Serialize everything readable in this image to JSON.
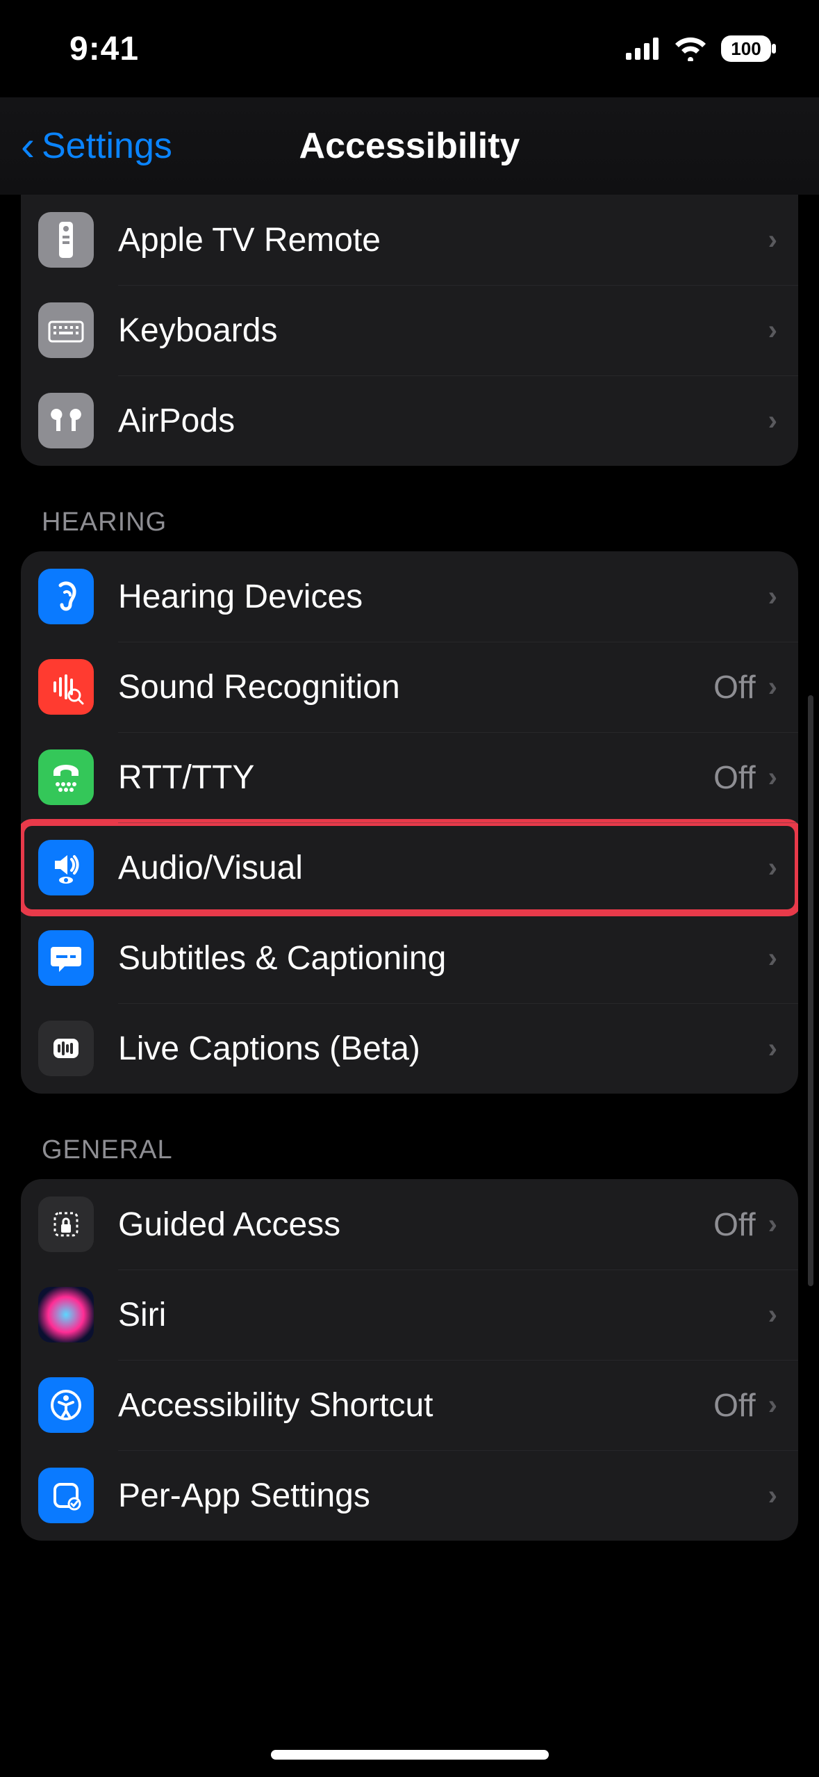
{
  "status": {
    "time": "9:41",
    "battery": "100"
  },
  "nav": {
    "back": "Settings",
    "title": "Accessibility"
  },
  "sections": {
    "physical": {
      "items": [
        {
          "label": "Apple TV Remote"
        },
        {
          "label": "Keyboards"
        },
        {
          "label": "AirPods"
        }
      ]
    },
    "hearing": {
      "header": "HEARING",
      "items": [
        {
          "label": "Hearing Devices"
        },
        {
          "label": "Sound Recognition",
          "value": "Off"
        },
        {
          "label": "RTT/TTY",
          "value": "Off"
        },
        {
          "label": "Audio/Visual"
        },
        {
          "label": "Subtitles & Captioning"
        },
        {
          "label": "Live Captions (Beta)"
        }
      ]
    },
    "general": {
      "header": "GENERAL",
      "items": [
        {
          "label": "Guided Access",
          "value": "Off"
        },
        {
          "label": "Siri"
        },
        {
          "label": "Accessibility Shortcut",
          "value": "Off"
        },
        {
          "label": "Per-App Settings"
        }
      ]
    }
  }
}
